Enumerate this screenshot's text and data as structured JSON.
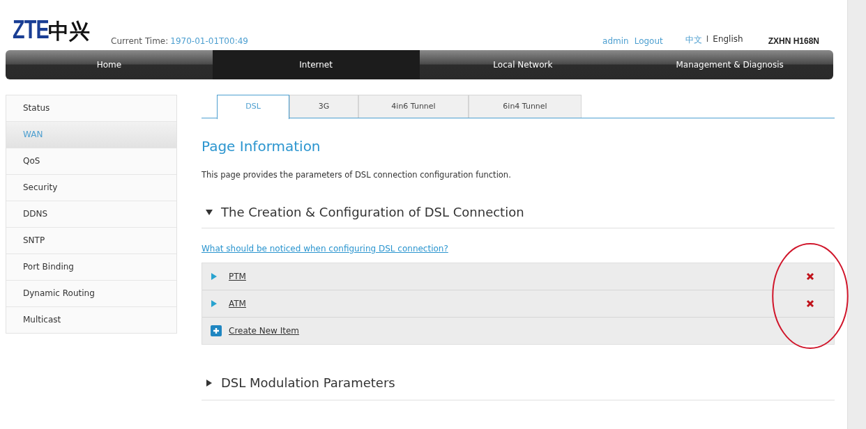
{
  "header": {
    "logo_latin": "ZTE",
    "logo_cjk": "中兴",
    "time_label": "Current Time:",
    "time_value": "1970-01-01T00:49",
    "user": "admin",
    "logout": "Logout",
    "languages": [
      {
        "label": "中文",
        "selected": false
      },
      {
        "label": "English",
        "selected": true
      }
    ],
    "language_separator": "I",
    "model": "ZXHN H168N"
  },
  "nav": [
    {
      "label": "Home",
      "selected": false
    },
    {
      "label": "Internet",
      "selected": true
    },
    {
      "label": "Local Network",
      "selected": false
    },
    {
      "label": "Management & Diagnosis",
      "selected": false
    }
  ],
  "sidebar": [
    {
      "label": "Status",
      "selected": false
    },
    {
      "label": "WAN",
      "selected": true
    },
    {
      "label": "QoS",
      "selected": false
    },
    {
      "label": "Security",
      "selected": false
    },
    {
      "label": "DDNS",
      "selected": false
    },
    {
      "label": "SNTP",
      "selected": false
    },
    {
      "label": "Port Binding",
      "selected": false
    },
    {
      "label": "Dynamic Routing",
      "selected": false
    },
    {
      "label": "Multicast",
      "selected": false
    }
  ],
  "tabs": [
    {
      "label": "DSL",
      "selected": true
    },
    {
      "label": "3G",
      "selected": false
    },
    {
      "label": "4in6 Tunnel",
      "selected": false
    },
    {
      "label": "6in4 Tunnel",
      "selected": false
    }
  ],
  "page_title": "Page Information",
  "description": "This page provides the parameters of DSL connection configuration function.",
  "sections": [
    {
      "title": "The Creation & Configuration of DSL Connection",
      "expanded": true,
      "help_link": "What should be noticed when configuring DSL connection?",
      "items": [
        {
          "label": "PTM",
          "kind": "entry"
        },
        {
          "label": "ATM",
          "kind": "entry"
        },
        {
          "label": "Create New Item",
          "kind": "create"
        }
      ]
    },
    {
      "title": "DSL Modulation Parameters",
      "expanded": false
    }
  ],
  "annotation": {
    "kind": "ellipse"
  }
}
